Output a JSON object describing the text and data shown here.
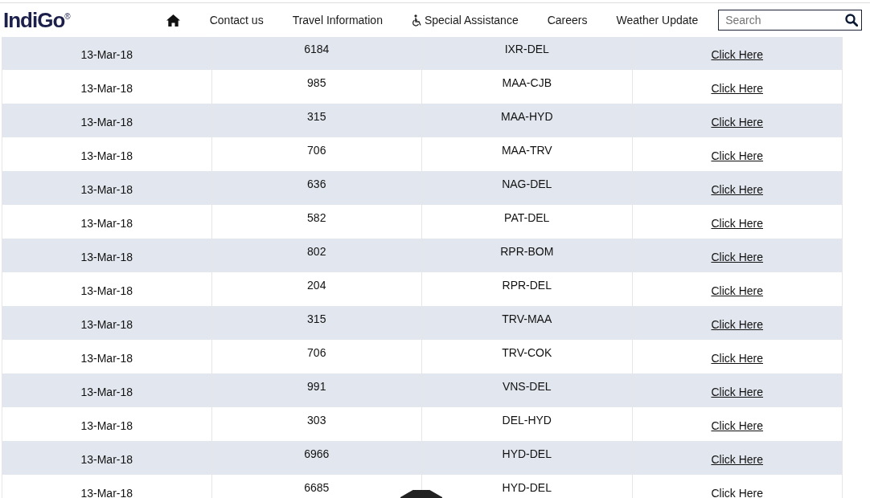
{
  "header": {
    "logo": "IndiGo$^{®}$",
    "nav": [
      {
        "kind": "home"
      },
      {
        "kind": "text",
        "label": "Contact us"
      },
      {
        "kind": "text",
        "label": "Travel Information"
      },
      {
        "kind": "accessibility",
        "label": "Special Assistance"
      },
      {
        "kind": "text",
        "label": "Careers"
      },
      {
        "kind": "text",
        "label": "Weather Update"
      }
    ],
    "search": {
      "placeholder": "Search"
    }
  },
  "table": {
    "rows": [
      {
        "date": "13-Mar-18",
        "flight": "6184",
        "route": "IXR-DEL",
        "link": "Click Here"
      },
      {
        "date": "13-Mar-18",
        "flight": "985",
        "route": "MAA-CJB",
        "link": "Click Here"
      },
      {
        "date": "13-Mar-18",
        "flight": "315",
        "route": "MAA-HYD",
        "link": "Click Here"
      },
      {
        "date": "13-Mar-18",
        "flight": "706",
        "route": "MAA-TRV",
        "link": "Click Here"
      },
      {
        "date": "13-Mar-18",
        "flight": "636",
        "route": "NAG-DEL",
        "link": "Click Here"
      },
      {
        "date": "13-Mar-18",
        "flight": "582",
        "route": "PAT-DEL",
        "link": "Click Here"
      },
      {
        "date": "13-Mar-18",
        "flight": "802",
        "route": "RPR-BOM",
        "link": "Click Here"
      },
      {
        "date": "13-Mar-18",
        "flight": "204",
        "route": "RPR-DEL",
        "link": "Click Here"
      },
      {
        "date": "13-Mar-18",
        "flight": "315",
        "route": "TRV-MAA",
        "link": "Click Here"
      },
      {
        "date": "13-Mar-18",
        "flight": "706",
        "route": "TRV-COK",
        "link": "Click Here"
      },
      {
        "date": "13-Mar-18",
        "flight": "991",
        "route": "VNS-DEL",
        "link": "Click Here"
      },
      {
        "date": "13-Mar-18",
        "flight": "303",
        "route": "DEL-HYD",
        "link": "Click Here"
      },
      {
        "date": "13-Mar-18",
        "flight": "6966",
        "route": "HYD-DEL",
        "link": "Click Here"
      },
      {
        "date": "13-Mar-18",
        "flight": "6685",
        "route": "HYD-DEL",
        "link": "Click Here"
      }
    ]
  }
}
